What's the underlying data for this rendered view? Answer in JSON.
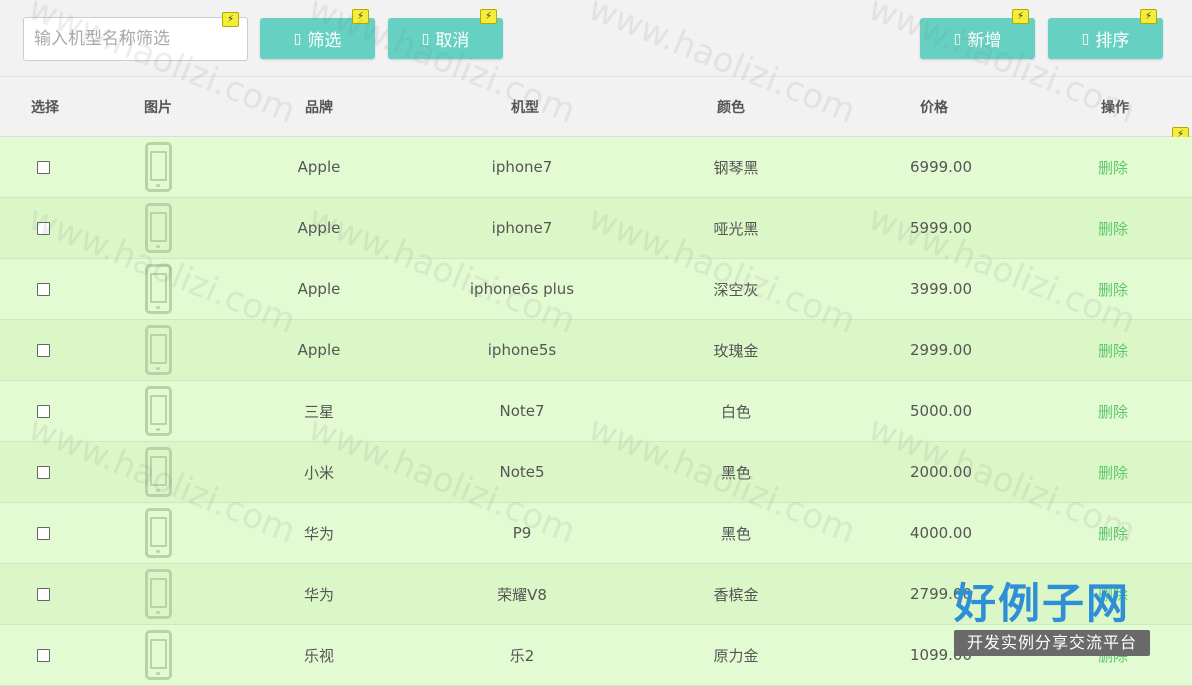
{
  "toolbar": {
    "search_placeholder": "输入机型名称筛选",
    "filter_label": "筛选",
    "cancel_label": "取消",
    "add_label": "新增",
    "sort_label": "排序"
  },
  "table": {
    "headers": [
      "选择",
      "图片",
      "品牌",
      "机型",
      "颜色",
      "价格",
      "操作"
    ],
    "rows": [
      {
        "brand": "Apple",
        "model": "iphone7",
        "color": "钢琴黑",
        "price": "6999.00",
        "action": "删除"
      },
      {
        "brand": "Apple",
        "model": "iphone7",
        "color": "哑光黑",
        "price": "5999.00",
        "action": "删除"
      },
      {
        "brand": "Apple",
        "model": "iphone6s plus",
        "color": "深空灰",
        "price": "3999.00",
        "action": "删除"
      },
      {
        "brand": "Apple",
        "model": "iphone5s",
        "color": "玫瑰金",
        "price": "2999.00",
        "action": "删除"
      },
      {
        "brand": "三星",
        "model": "Note7",
        "color": "白色",
        "price": "5000.00",
        "action": "删除"
      },
      {
        "brand": "小米",
        "model": "Note5",
        "color": "黑色",
        "price": "2000.00",
        "action": "删除"
      },
      {
        "brand": "华为",
        "model": "P9",
        "color": "黑色",
        "price": "4000.00",
        "action": "删除"
      },
      {
        "brand": "华为",
        "model": "荣耀V8",
        "color": "香槟金",
        "price": "2799.00",
        "action": "删除"
      },
      {
        "brand": "乐视",
        "model": "乐2",
        "color": "原力金",
        "price": "1099.00",
        "action": "删除"
      }
    ]
  },
  "watermark": {
    "text": "www.haolizi.com",
    "logo_title": "好例子网",
    "logo_subtitle": "开发实例分享交流平台"
  },
  "colors": {
    "button": "#66d1c3",
    "row_bg": "#e3fbd2",
    "delete_link": "#5cc76a",
    "logo_blue": "#2f8fd6"
  }
}
